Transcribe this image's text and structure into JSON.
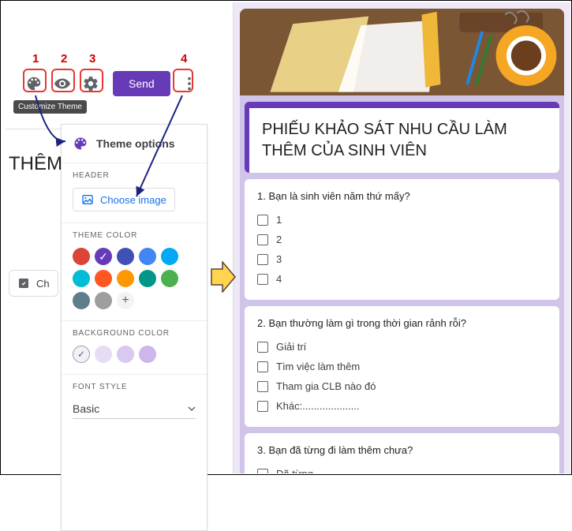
{
  "annotations": {
    "n1": "1",
    "n2": "2",
    "n3": "3",
    "n4": "4"
  },
  "toolbar": {
    "send_label": "Send",
    "tooltip_customize": "Customize Theme"
  },
  "left_bg": {
    "title_fragment": "THÊM",
    "checkbox_fragment": "Ch"
  },
  "panel": {
    "title": "Theme options",
    "header_label": "HEADER",
    "choose_image": "Choose image",
    "theme_color_label": "THEME COLOR",
    "bg_color_label": "BACKGROUND COLOR",
    "font_style_label": "FONT STYLE",
    "font_value": "Basic",
    "theme_colors": [
      {
        "hex": "#db4437",
        "selected": false
      },
      {
        "hex": "#673ab7",
        "selected": true
      },
      {
        "hex": "#3f51b5",
        "selected": false
      },
      {
        "hex": "#4285f4",
        "selected": false
      },
      {
        "hex": "#03a9f4",
        "selected": false
      },
      {
        "hex": "#00bcd4",
        "selected": false
      },
      {
        "hex": "#ff5722",
        "selected": false
      },
      {
        "hex": "#ff9800",
        "selected": false
      },
      {
        "hex": "#009688",
        "selected": false
      },
      {
        "hex": "#4caf50",
        "selected": false
      },
      {
        "hex": "#607d8b",
        "selected": false
      },
      {
        "hex": "#9e9e9e",
        "selected": false
      }
    ],
    "bg_colors": [
      {
        "hex": "#f3f0fa",
        "selected": true
      },
      {
        "hex": "#e6ddf5",
        "selected": false
      },
      {
        "hex": "#d9c9f0",
        "selected": false
      },
      {
        "hex": "#ccb6eb",
        "selected": false
      }
    ]
  },
  "form": {
    "title": "PHIẾU KHẢO SÁT NHU CẦU LÀM THÊM CỦA SINH VIÊN",
    "q1": {
      "text": "1. Bạn là sinh viên năm thứ mấy?",
      "opts": [
        "1",
        "2",
        "3",
        "4"
      ]
    },
    "q2": {
      "text": "2. Bạn thường làm gì trong thời gian rảnh rỗi?",
      "opts": [
        "Giải trí",
        "Tìm việc làm thêm",
        "Tham gia CLB nào đó",
        "Khác:...................."
      ]
    },
    "q3": {
      "text": "3. Bạn đã từng đi làm thêm chưa?",
      "opts": [
        "Đã từng"
      ]
    }
  }
}
